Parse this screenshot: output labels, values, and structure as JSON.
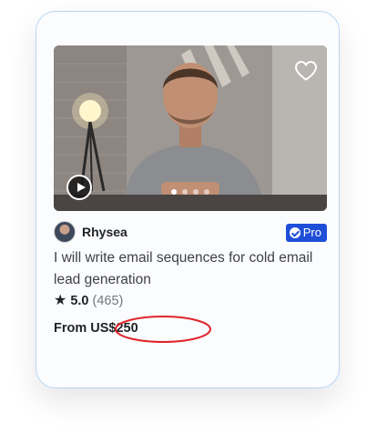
{
  "card": {
    "seller": {
      "name": "Rhysea",
      "badge": "Pro"
    },
    "media": {
      "slide_count": 4,
      "active_slide": 1
    },
    "title": "I will write email sequences for cold email lead generation",
    "rating": {
      "score": "5.0",
      "count": "(465)"
    },
    "price": {
      "prefix": "From",
      "amount": "US$250"
    }
  },
  "colors": {
    "card_border": "#b9d6f2",
    "pro_badge": "#1f4ed8",
    "annotation_circle": "#e0242b",
    "text_primary": "#222325",
    "text_secondary": "#74767e"
  },
  "icons": {
    "favorite": "heart-outline-icon",
    "play": "play-icon",
    "verified": "check-badge-icon",
    "rating": "star-icon"
  }
}
